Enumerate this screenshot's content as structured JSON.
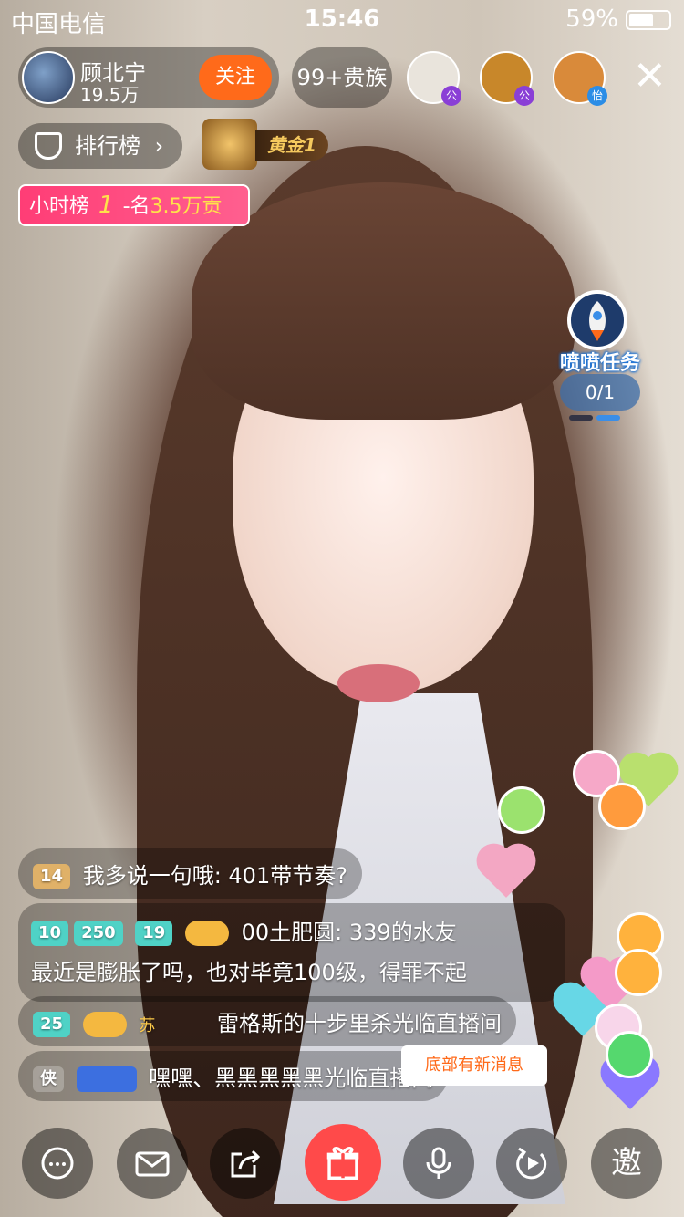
{
  "status_bar": {
    "carrier": "中国电信",
    "time": "15:46",
    "battery_pct": "59%"
  },
  "host": {
    "name": "顾北宁",
    "fans": "19.5万",
    "follow_label": "关注"
  },
  "vip_label": "99+贵族",
  "viewers": [
    {
      "badge": "公",
      "badge_color": "#8a3fd6",
      "color": "#e9e4dc"
    },
    {
      "badge": "公",
      "badge_color": "#8a3fd6",
      "color": "#c8872a"
    },
    {
      "badge": "怡",
      "badge_color": "#2b8de6",
      "color": "#d98a3a"
    }
  ],
  "ranking": {
    "label": "排行榜",
    "chevron": "›"
  },
  "tier": {
    "label": "黄金1"
  },
  "hourly": {
    "board": "小时榜",
    "rank": "1",
    "rest": "-名",
    "amount": "3.5万贡"
  },
  "mission": {
    "title": "喷喷任务",
    "progress": "0/1"
  },
  "chat": {
    "m1": {
      "level": "14",
      "text": "我多说一句哦: 401带节奏?"
    },
    "m2": {
      "level_a": "10",
      "level_a_num": "250",
      "level_b": "19",
      "name": "00土肥圆:",
      "text": "339的水友",
      "text2": "最近是膨胀了吗，也对毕竟100级，得罪不起"
    },
    "m3": {
      "level": "25",
      "car_label": "苏",
      "text": "雷格斯的十步里杀光临直播间"
    },
    "m4": {
      "guild": "侠",
      "text": "嘿嘿、黑黑黑黑黑光临直播间"
    }
  },
  "new_message": "底部有新消息",
  "bottom": {
    "invite_label": "邀"
  }
}
